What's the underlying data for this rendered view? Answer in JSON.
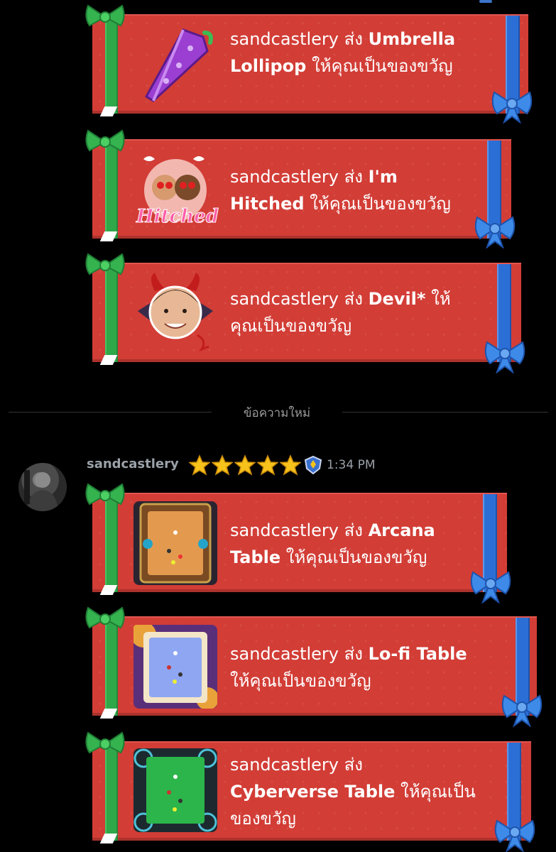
{
  "gifts_before": [
    {
      "sender": "sandcastlery",
      "verb": "ส่ง",
      "item": "Umbrella Lollipop",
      "suffix": "ให้คุณเป็นของขวัญ",
      "line1_pre": "sandcastlery ส่ง ",
      "line1_item": "Umbrella",
      "line2_item": "Lollipop",
      "line2_post": " ให้คุณเป็นของขวัญ",
      "thumb": "umbrella-lollipop"
    },
    {
      "sender": "sandcastlery",
      "verb": "ส่ง",
      "item": "I'm Hitched",
      "suffix": "ให้คุณเป็นของขวัญ",
      "line1_pre": "sandcastlery ส่ง ",
      "line1_item": "I'm",
      "line2_item": "Hitched",
      "line2_post": " ให้คุณเป็นของขวัญ",
      "thumb": "hitched-couple",
      "thumb_text": "Hitched"
    },
    {
      "sender": "sandcastlery",
      "verb": "ส่ง",
      "item": "Devil*",
      "suffix": "ให้คุณเป็นของขวัญ",
      "line1_pre": "sandcastlery ส่ง ",
      "line1_item": "Devil*",
      "line1_post": " ให้",
      "line2_post": "คุณเป็นของขวัญ",
      "thumb": "devil-face"
    }
  ],
  "divider": {
    "label": "ข้อความใหม่"
  },
  "message": {
    "username": "sandcastlery",
    "stars": 5,
    "badge": "shield-badge",
    "time": "1:34 PM"
  },
  "gifts_after": [
    {
      "sender": "sandcastlery",
      "verb": "ส่ง",
      "item": "Arcana Table",
      "suffix": "ให้คุณเป็นของขวัญ",
      "line1_pre": "sandcastlery ส่ง ",
      "line1_item": "Arcana",
      "line2_item": "Table",
      "line2_post": " ให้คุณเป็นของขวัญ",
      "thumb": "arcana-table"
    },
    {
      "sender": "sandcastlery",
      "verb": "ส่ง",
      "item": "Lo-fi Table",
      "suffix": "ให้คุณเป็นของขวัญ",
      "line1_pre": "sandcastlery ส่ง ",
      "line1_item": "Lo-fi Table",
      "line2_post": "ให้คุณเป็นของขวัญ",
      "thumb": "lofi-table"
    },
    {
      "sender": "sandcastlery",
      "verb": "ส่ง",
      "item": "Cyberverse Table",
      "suffix": "ให้คุณเป็นของขวัญ",
      "line1_pre": "sandcastlery ส่ง",
      "line2_item": "Cyberverse Table",
      "line2_post": " ให้คุณเป็น",
      "line3_post": "ของขวัญ",
      "thumb": "cyberverse-table"
    }
  ],
  "colors": {
    "card": "#d23d36",
    "ribbon_green": "#2fa84a",
    "ribbon_blue": "#2b6fd6",
    "muted_text": "#9aa1a8"
  }
}
